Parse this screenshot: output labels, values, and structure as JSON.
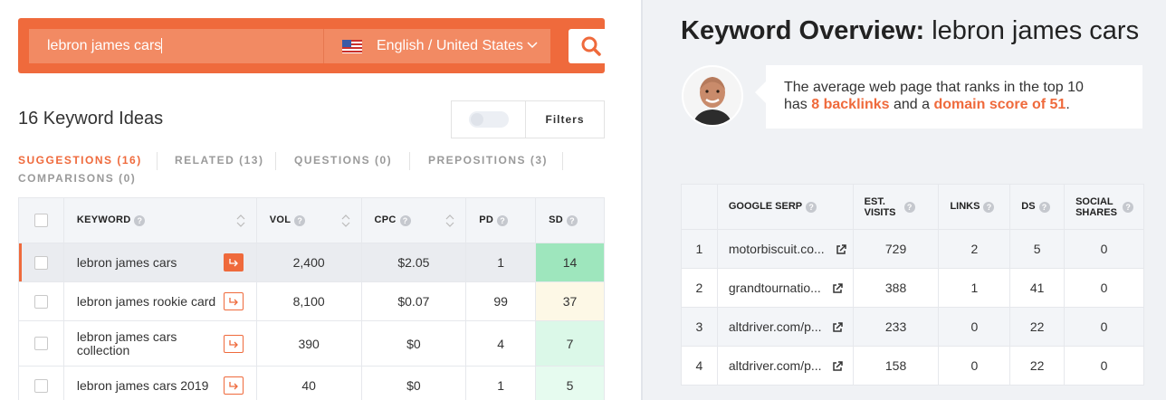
{
  "search": {
    "query": "lebron james cars",
    "language": "English / United States"
  },
  "ideas": {
    "title": "16 Keyword Ideas",
    "filters_label": "Filters"
  },
  "tabs": [
    {
      "label": "SUGGESTIONS (16)"
    },
    {
      "label": "RELATED (13)"
    },
    {
      "label": "QUESTIONS (0)"
    },
    {
      "label": "PREPOSITIONS (3)"
    },
    {
      "label": "COMPARISONS (0)"
    }
  ],
  "keyword_table": {
    "headers": {
      "keyword": "KEYWORD",
      "vol": "VOL",
      "cpc": "CPC",
      "pd": "PD",
      "sd": "SD"
    },
    "rows": [
      {
        "keyword": "lebron james cars",
        "vol": "2,400",
        "cpc": "$2.05",
        "pd": "1",
        "sd": "14",
        "sd_color": "#9ee6bd"
      },
      {
        "keyword": "lebron james rookie card",
        "vol": "8,100",
        "cpc": "$0.07",
        "pd": "99",
        "sd": "37",
        "sd_color": "#fdf8e6"
      },
      {
        "keyword": "lebron james cars collection",
        "vol": "390",
        "cpc": "$0",
        "pd": "4",
        "sd": "7",
        "sd_color": "#dbf8e8"
      },
      {
        "keyword": "lebron james cars 2019",
        "vol": "40",
        "cpc": "$0",
        "pd": "1",
        "sd": "5",
        "sd_color": "#e6fbef"
      }
    ]
  },
  "overview": {
    "title_bold": "Keyword Overview:",
    "title_keyword": "lebron james cars",
    "bubble_line1": "The average web page that ranks in the top 10",
    "bubble_has": "has",
    "bubble_backlinks": "8 backlinks",
    "bubble_and": "and a",
    "bubble_domain": "domain score of 51",
    "bubble_end": "."
  },
  "serp_table": {
    "headers": {
      "serp": "GOOGLE SERP",
      "visits": "EST. VISITS",
      "links": "LINKS",
      "ds": "DS",
      "social": "SOCIAL SHARES"
    },
    "rows": [
      {
        "rank": "1",
        "url": "motorbiscuit.co...",
        "visits": "729",
        "links": "2",
        "ds": "5",
        "social": "0"
      },
      {
        "rank": "2",
        "url": "grandtournatio...",
        "visits": "388",
        "links": "1",
        "ds": "41",
        "social": "0"
      },
      {
        "rank": "3",
        "url": "altdriver.com/p...",
        "visits": "233",
        "links": "0",
        "ds": "22",
        "social": "0"
      },
      {
        "rank": "4",
        "url": "altdriver.com/p...",
        "visits": "158",
        "links": "0",
        "ds": "22",
        "social": "0"
      }
    ]
  },
  "colors": {
    "accent": "#ef6a3c"
  }
}
